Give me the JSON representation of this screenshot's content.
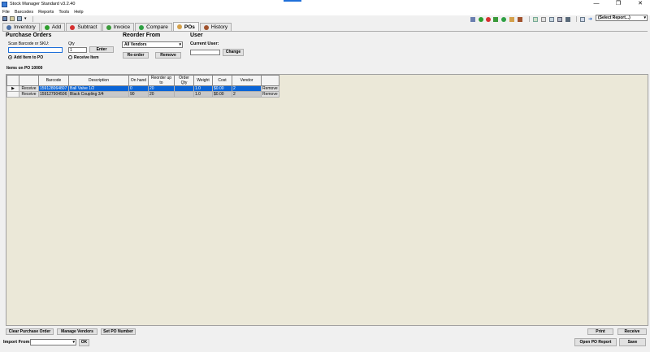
{
  "window": {
    "title": "Stock Manager Standard v3.2.40",
    "minimize": "—",
    "restore": "❐",
    "close": "✕"
  },
  "menu": [
    "File",
    "Barcodes",
    "Reports",
    "Tools",
    "Help"
  ],
  "toolbar": {
    "report_select": "(Select Report...)"
  },
  "tabs": [
    {
      "label": "Inventory",
      "icon": "inventory-icon",
      "color": "#4a6fa5",
      "active": false
    },
    {
      "label": "Add",
      "icon": "add-icon",
      "color": "#2e9e2e",
      "active": false
    },
    {
      "label": "Subtract",
      "icon": "subtract-icon",
      "color": "#d62f2f",
      "active": false
    },
    {
      "label": "Invoice",
      "icon": "invoice-icon",
      "color": "#3a9a3a",
      "active": false
    },
    {
      "label": "Compare",
      "icon": "compare-icon",
      "color": "#2ea043",
      "active": false
    },
    {
      "label": "POs",
      "icon": "po-icon",
      "color": "#d4a04a",
      "active": true
    },
    {
      "label": "History",
      "icon": "history-icon",
      "color": "#a0522d",
      "active": false
    }
  ],
  "purchase_orders": {
    "title": "Purchase Orders",
    "scan_label": "Scan Barcode or SKU:",
    "scan_value": "",
    "qty_label": "Qty",
    "qty_value": "1",
    "enter_button": "Enter",
    "add_radio": "Add Item to PO",
    "receive_radio": "Receive Item"
  },
  "reorder": {
    "title": "Reorder From",
    "vendor_select": "All Vendors",
    "reorder_button": "Re-order",
    "remove_button": "Remove"
  },
  "user": {
    "title": "User",
    "current_label": "Current User:",
    "current_value": "",
    "change_button": "Change"
  },
  "items_label": "Items on PO 10000",
  "grid": {
    "columns": [
      "",
      "",
      "Barcode",
      "Description",
      "On hand",
      "Reorder up to",
      "Order Qty",
      "Weight",
      "Cost",
      "Vendor",
      ""
    ],
    "rows": [
      {
        "marker": "▶",
        "action": "Receive",
        "barcode": "159128064807",
        "description": "Ball Valve 1/2",
        "on_hand": "0",
        "reorder_up_to": "20",
        "order_qty": "",
        "weight": "1.0",
        "cost": "$0.00",
        "vendor": "2",
        "remove": "Remove"
      },
      {
        "marker": "",
        "action": "Receive",
        "barcode": "159127904506",
        "description": "Black Coupling 3/4",
        "on_hand": "90",
        "reorder_up_to": "20",
        "order_qty": "",
        "weight": "1.0",
        "cost": "$0.00",
        "vendor": "2",
        "remove": "Remove"
      }
    ]
  },
  "bottom": {
    "clear_po": "Clear Purchase Order",
    "manage_vendors": "Manage Vendors",
    "set_po_number": "Set PO Number",
    "print": "Print",
    "receive": "Receive",
    "import_from": "Import From:",
    "import_value": "",
    "ok": "OK",
    "open_po_report": "Open PO Report",
    "save": "Save"
  }
}
